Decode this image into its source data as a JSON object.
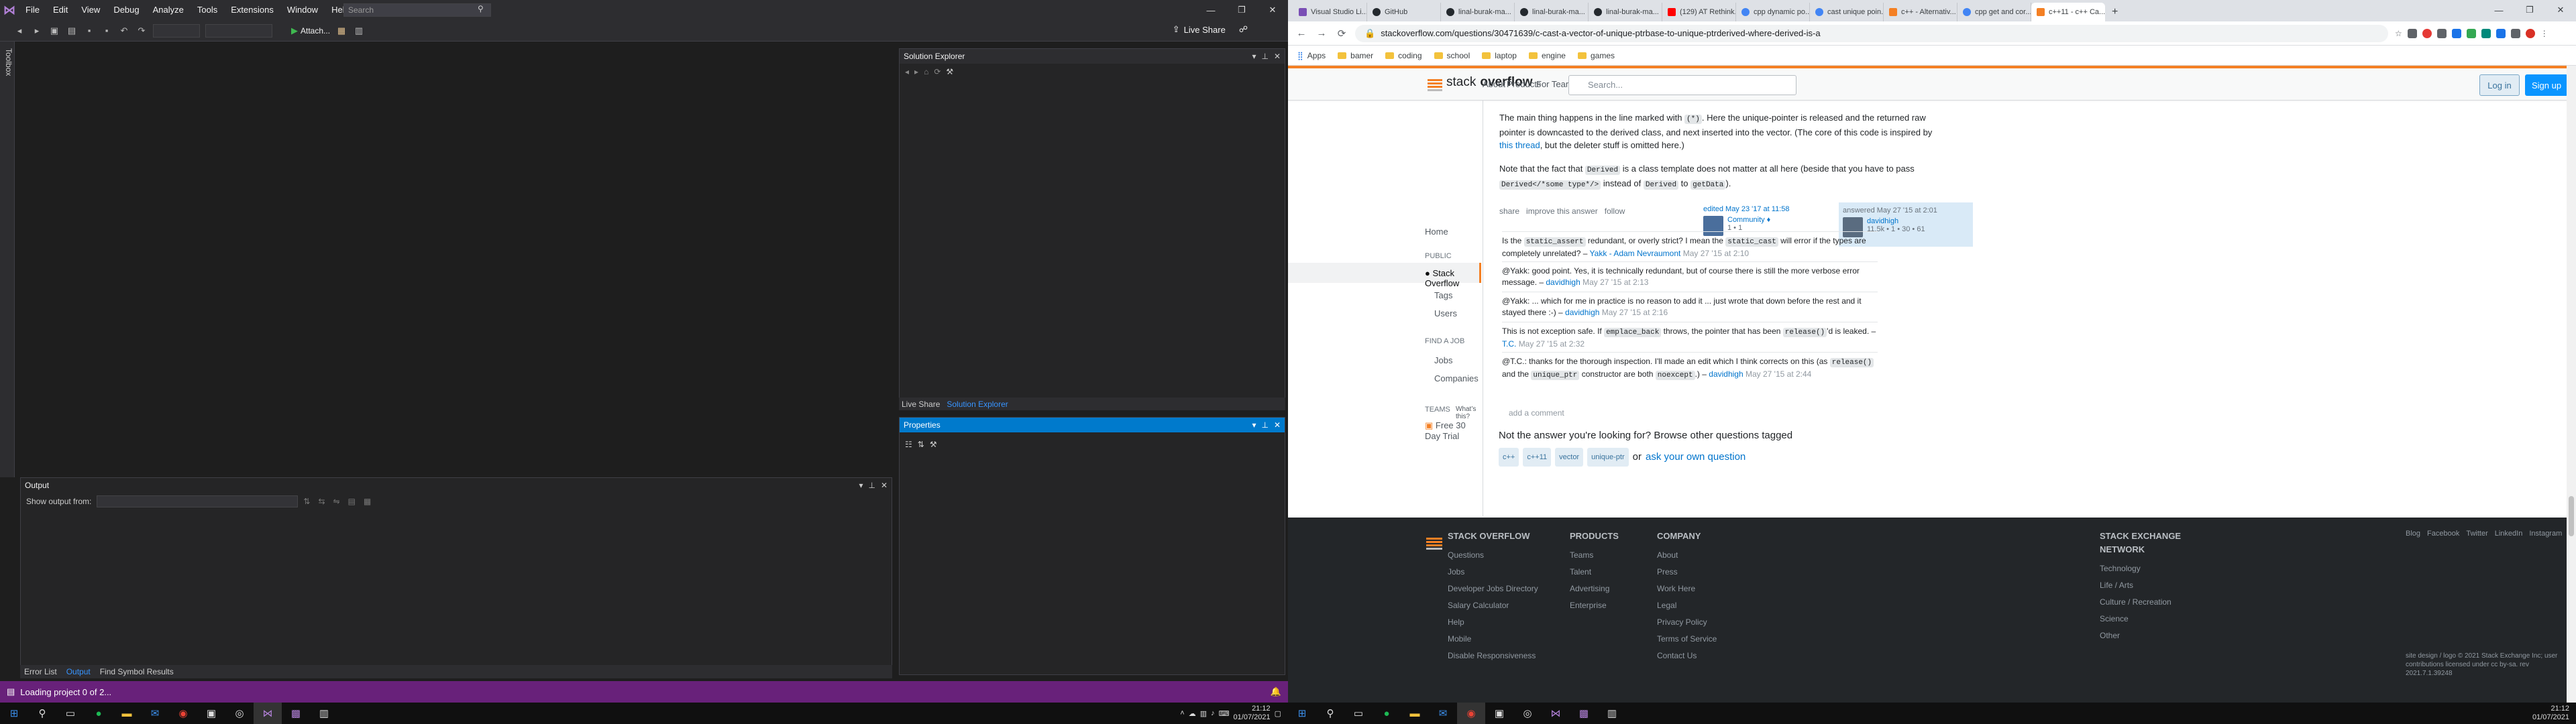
{
  "vs": {
    "menus": [
      "File",
      "Edit",
      "View",
      "Debug",
      "Analyze",
      "Tools",
      "Extensions",
      "Window",
      "Help"
    ],
    "search_placeholder": "Search",
    "attach_label": "Attach...",
    "live_share": "Live Share",
    "toolbox_label": "Toolbox",
    "solution_explorer": {
      "title": "Solution Explorer"
    },
    "bottom_tabs": [
      "Live Share",
      "Solution Explorer"
    ],
    "properties": {
      "title": "Properties"
    },
    "output": {
      "title": "Output",
      "show_from": "Show output from:"
    },
    "output_tabs": [
      "Error List",
      "Output",
      "Find Symbol Results"
    ],
    "status": "Loading project 0 of 2..."
  },
  "taskbar_left": {
    "time": "21:12",
    "date": "01/07/2021"
  },
  "taskbar_right": {
    "time": "21:12",
    "date": "01/07/2021"
  },
  "chrome": {
    "tabs": [
      {
        "label": "Visual Studio Li...",
        "color": "#7a4fb5"
      },
      {
        "label": "GitHub",
        "color": "#24292e"
      },
      {
        "label": "linal-burak-ma...",
        "color": "#24292e"
      },
      {
        "label": "linal-burak-ma...",
        "color": "#24292e"
      },
      {
        "label": "linal-burak-ma...",
        "color": "#24292e"
      },
      {
        "label": "(129) AT Rethink...",
        "color": "#ff0000"
      },
      {
        "label": "cpp dynamic po...",
        "color": "#4285f4"
      },
      {
        "label": "cast unique poin...",
        "color": "#4285f4"
      },
      {
        "label": "c++ - Alternativ...",
        "color": "#f48024"
      },
      {
        "label": "cpp get and cor...",
        "color": "#4285f4"
      },
      {
        "label": "c++11 - c++ Ca...",
        "color": "#f48024",
        "active": true
      }
    ],
    "url": "stackoverflow.com/questions/30471639/c-cast-a-vector-of-unique-ptrbase-to-unique-ptrderived-where-derived-is-a",
    "bookmarks": [
      "Apps",
      "bamer",
      "coding",
      "school",
      "laptop",
      "engine",
      "games"
    ]
  },
  "so": {
    "nav": [
      "About",
      "Products",
      "For Teams"
    ],
    "search_placeholder": "Search...",
    "login": "Log in",
    "signup": "Sign up",
    "logo_a": "stack",
    "logo_b": "overflow",
    "sidebar": {
      "home": "Home",
      "public": "PUBLIC",
      "so": "Stack Overflow",
      "tags": "Tags",
      "users": "Users",
      "find_job": "FIND A JOB",
      "jobs": "Jobs",
      "companies": "Companies",
      "teams": "TEAMS",
      "whats_this": "What’s this?",
      "trial": "Free 30 Day Trial"
    },
    "answer": {
      "p1a": "The main thing happens in the line marked with ",
      "p1code": "(*)",
      "p1b": ". Here the unique-pointer is released and the returned raw pointer is downcasted to the derived class, and next inserted into the vector. (The core of this code is inspired by ",
      "p1link": "this thread",
      "p1c": ", but the deleter stuff is omitted here.)",
      "p2a": "Note that the fact that ",
      "p2code1": "Derived",
      "p2b": " is a class template does not matter at all here (beside that you have to pass ",
      "p2code2": "Derived</*some type*/>",
      "p2c": " instead of ",
      "p2code3": "Derived",
      "p2d": " to ",
      "p2code4": "getData",
      "p2e": ").",
      "menu": [
        "share",
        "improve this answer",
        "follow"
      ],
      "edited": "edited May 23 '17 at 11:58",
      "editor": "Community ♦",
      "editor_rep": "1 • 1",
      "answered": "answered May 27 '15 at 2:01",
      "author": "davidhigh",
      "author_rep": "11.5k • 1 • 30 • 61"
    },
    "comments": [
      {
        "pre": "Is the ",
        "code": "static_assert",
        "mid": " redundant, or overly strict? I mean the ",
        "code2": "static_cast",
        "post": " will error if the types are completely unrelated? – ",
        "user": "Yakk - Adam Nevraumont",
        "date": "May 27 '15 at 2:10"
      },
      {
        "pre": "@Yakk: good point. Yes, it is technically redundant, but of course there is still the more verbose error message. – ",
        "user": "davidhigh",
        "date": "May 27 '15 at 2:13"
      },
      {
        "pre": "@Yakk: ... which for me in practice is no reason to add it ... just wrote that down before the rest and it stayed there :-) – ",
        "user": "davidhigh",
        "date": "May 27 '15 at 2:16"
      },
      {
        "pre": "This is not exception safe. If ",
        "code": "emplace_back",
        "mid": " throws, the pointer that has been ",
        "code2": "release()",
        "post": "'d is leaked. – ",
        "user": "T.C.",
        "date": "May 27 '15 at 2:32"
      },
      {
        "pre": "@T.C.: thanks for the thorough inspection. I'll made an edit which I think corrects on this (as ",
        "code": "release()",
        "mid": " and the ",
        "code2": "unique_ptr",
        "post": " constructor are both ",
        "code3": "noexcept",
        "post2": ".) – ",
        "user": "davidhigh",
        "date": "May 27 '15 at 2:44"
      }
    ],
    "add_comment": "add a comment",
    "not_answer": "Not the answer you're looking for? Browse other questions tagged",
    "tags": [
      "c++",
      "c++11",
      "vector",
      "unique-ptr"
    ],
    "or": "or",
    "ask_own": "ask your own question",
    "footer": {
      "col1": {
        "head": "STACK OVERFLOW",
        "items": [
          "Questions",
          "Jobs",
          "Developer Jobs Directory",
          "Salary Calculator",
          "Help",
          "Mobile",
          "Disable Responsiveness"
        ]
      },
      "col2": {
        "head": "PRODUCTS",
        "items": [
          "Teams",
          "Talent",
          "Advertising",
          "Enterprise"
        ]
      },
      "col3": {
        "head": "COMPANY",
        "items": [
          "About",
          "Press",
          "Work Here",
          "Legal",
          "Privacy Policy",
          "Terms of Service",
          "Contact Us"
        ]
      },
      "col4": {
        "head": "STACK EXCHANGE NETWORK",
        "items": [
          "Technology",
          "Life / Arts",
          "Culture / Recreation",
          "Science",
          "Other"
        ]
      },
      "social": [
        "Blog",
        "Facebook",
        "Twitter",
        "LinkedIn",
        "Instagram"
      ],
      "copyright": "site design / logo © 2021 Stack Exchange Inc; user contributions licensed under cc by-sa. rev 2021.7.1.39248"
    }
  }
}
